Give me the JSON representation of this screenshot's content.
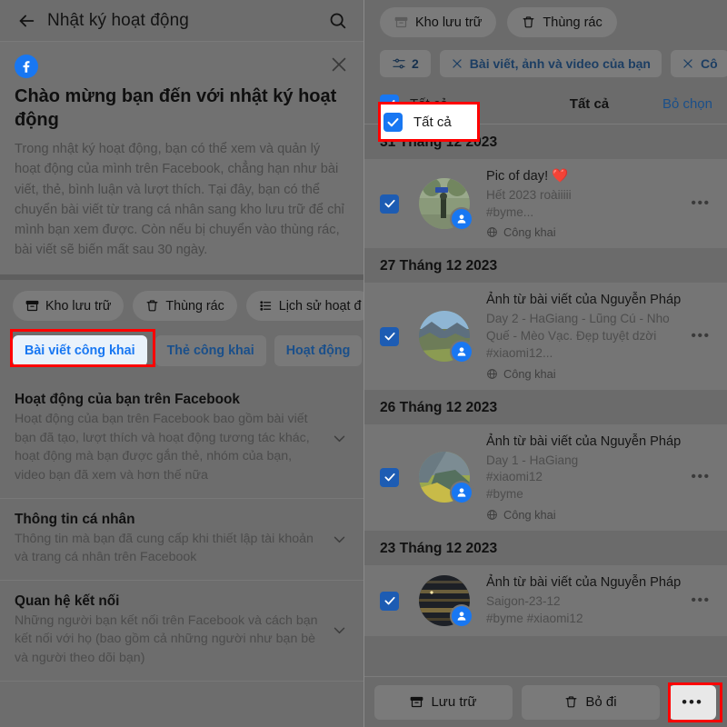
{
  "left": {
    "header": {
      "title": "Nhật ký hoạt động",
      "back_icon": "arrow-left-icon",
      "search_icon": "search-icon"
    },
    "card": {
      "close_icon": "close-icon",
      "logo": "facebook-logo-icon",
      "title": "Chào mừng bạn đến với nhật ký hoạt động",
      "body": "Trong nhật ký hoạt động, bạn có thể xem và quản lý hoạt động của mình trên Facebook, chẳng hạn như bài viết, thẻ, bình luận và lượt thích. Tại đây, bạn có thể chuyển bài viết từ trang cá nhân sang kho lưu trữ để chỉ mình bạn xem được. Còn nếu bị chuyển vào thùng rác, bài viết sẽ biến mất sau 30 ngày."
    },
    "chips": [
      {
        "label": "Kho lưu trữ",
        "icon": "archive-icon"
      },
      {
        "label": "Thùng rác",
        "icon": "trash-icon"
      },
      {
        "label": "Lịch sử hoạt đ",
        "icon": "list-icon"
      }
    ],
    "tabs": [
      {
        "label": "Bài viết công khai",
        "active": true
      },
      {
        "label": "Thẻ công khai",
        "active": false
      },
      {
        "label": "Hoạt động",
        "active": false
      }
    ],
    "sections": [
      {
        "title": "Hoạt động của bạn trên Facebook",
        "desc": "Hoạt động của bạn trên Facebook bao gồm bài viết bạn đã tạo, lượt thích và hoạt động tương tác khác, hoạt động mà bạn được gắn thẻ, nhóm của bạn, video bạn đã xem và hơn thế nữa",
        "chevron": "chevron-down-icon"
      },
      {
        "title": "Thông tin cá nhân",
        "desc": "Thông tin mà bạn đã cung cấp khi thiết lập tài khoản và trang cá nhân trên Facebook",
        "chevron": "chevron-down-icon"
      },
      {
        "title": "Quan hệ kết nối",
        "desc": "Những người bạn kết nối trên Facebook và cách bạn kết nối với họ (bao gồm cả những người như bạn bè và người theo dõi bạn)",
        "chevron": "chevron-down-icon"
      }
    ]
  },
  "right": {
    "chips": [
      {
        "label": "Kho lưu trữ",
        "icon": "archive-icon"
      },
      {
        "label": "Thùng rác",
        "icon": "trash-icon"
      }
    ],
    "filters": [
      {
        "label": "2",
        "icon": "filter-sliders-icon",
        "type": "count"
      },
      {
        "label": "Bài viết, ảnh và video của bạn",
        "icon": "close-icon",
        "type": "removable"
      },
      {
        "label": "Cô",
        "icon": "close-icon",
        "type": "removable"
      }
    ],
    "select_bar": {
      "checkbox_checked": true,
      "checkbox_icon": "checkmark-icon",
      "left_label": "Tất cả",
      "center_label": "Tất cả",
      "right_label": "Bỏ chọn"
    },
    "groups": [
      {
        "date": "31 Tháng 12 2023",
        "posts": [
          {
            "checked": true,
            "title": "Pic of day! ❤️",
            "sub": "Hết 2023 roàiiiii\n#byme...",
            "privacy": "Công khai",
            "privacy_icon": "globe-icon",
            "more_icon": "more-horizontal-icon",
            "badge_icon": "person-icon",
            "thumb": "photo-park-statue"
          }
        ]
      },
      {
        "date": "27 Tháng 12 2023",
        "posts": [
          {
            "checked": true,
            "title": "Ảnh từ bài viết của Nguyễn Pháp",
            "sub": "Day 2 - HaGiang - Lũng Cú - Nho Quế - Mèo Vạc. Đẹp tuyệt dzời #xiaomi12...",
            "privacy": "Công khai",
            "privacy_icon": "globe-icon",
            "more_icon": "more-horizontal-icon",
            "badge_icon": "person-icon",
            "thumb": "photo-mountain-range"
          }
        ]
      },
      {
        "date": "26 Tháng 12 2023",
        "posts": [
          {
            "checked": true,
            "title": "Ảnh từ bài viết của Nguyễn Pháp",
            "sub": "Day 1 - HaGiang\n#xiaomi12\n#byme",
            "privacy": "Công khai",
            "privacy_icon": "globe-icon",
            "more_icon": "more-horizontal-icon",
            "badge_icon": "person-icon",
            "thumb": "photo-valley-yellow"
          }
        ]
      },
      {
        "date": "23 Tháng 12 2023",
        "posts": [
          {
            "checked": true,
            "title": "Ảnh từ bài viết của Nguyễn Pháp",
            "sub": "Saigon-23-12\n#byme #xiaomi12",
            "privacy": "",
            "privacy_icon": "globe-icon",
            "more_icon": "more-horizontal-icon",
            "badge_icon": "person-icon",
            "thumb": "photo-city-night"
          }
        ]
      }
    ],
    "bottom_bar": {
      "archive_label": "Lưu trữ",
      "archive_icon": "archive-icon",
      "discard_label": "Bỏ đi",
      "discard_icon": "trash-icon",
      "more_label": "•••",
      "more_icon": "more-horizontal-icon"
    }
  },
  "annotations": {
    "highlight_color": "#ff0000",
    "boxes": [
      "left-active-tab",
      "right-select-all-checkbox",
      "right-bottom-more-button"
    ]
  }
}
